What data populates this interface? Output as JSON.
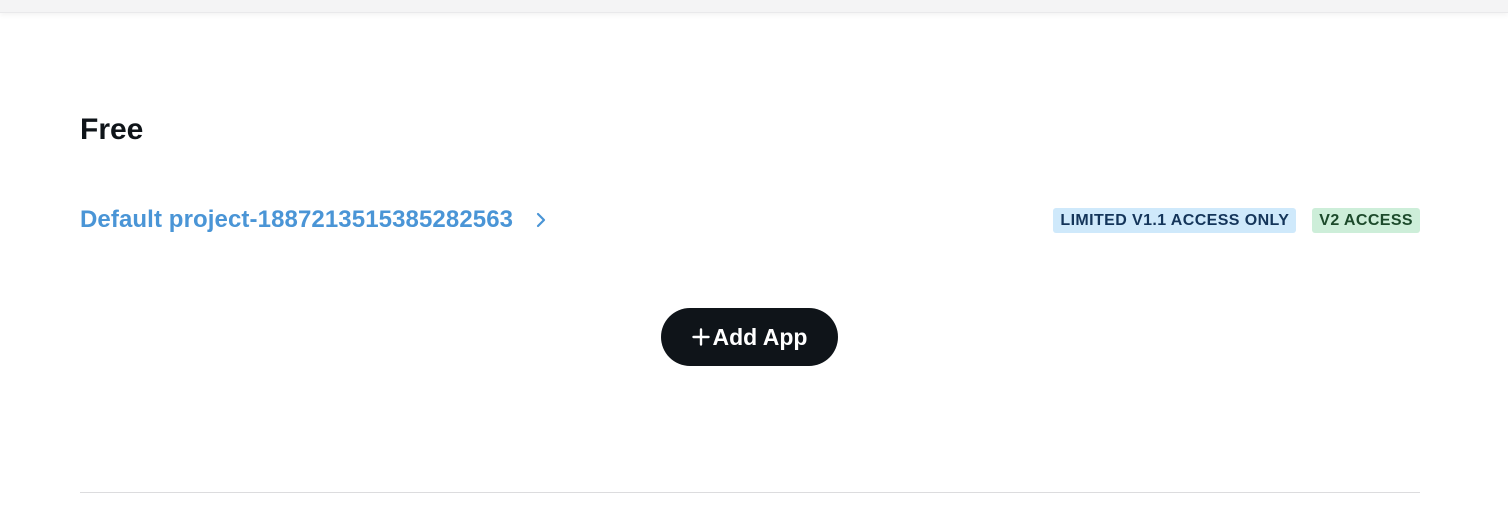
{
  "section": {
    "title": "Free"
  },
  "project": {
    "name": "Default project-1887213515385282563",
    "chevron_icon": "chevron-right-icon",
    "link_color": "#4a95d6",
    "badges": [
      {
        "label": "LIMITED V1.1 ACCESS ONLY",
        "background": "#cfe9fb",
        "color": "#14355a"
      },
      {
        "label": "V2 ACCESS",
        "background": "#cdeed9",
        "color": "#1c4a2b"
      }
    ]
  },
  "actions": {
    "add_app_label": "Add App",
    "add_app_icon": "plus-icon",
    "button_color": "#0f1419"
  }
}
